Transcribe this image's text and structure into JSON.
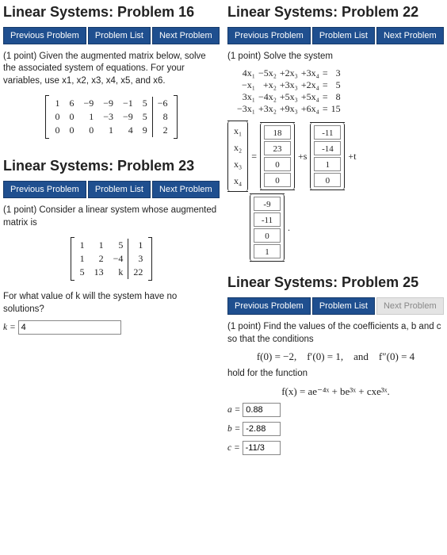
{
  "nav": {
    "prev": "Previous Problem",
    "list": "Problem List",
    "next": "Next Problem"
  },
  "p16": {
    "title": "Linear Systems: Problem 16",
    "prompt": "(1 point) Given the augmented matrix below, solve the associated system of equations. For your variables, use x1, x2, x3, x4, x5, and x6.",
    "matrix": {
      "rows": [
        [
          "1",
          "6",
          "−9",
          "−9",
          "−1",
          "5",
          "−6"
        ],
        [
          "0",
          "0",
          "1",
          "−3",
          "−9",
          "5",
          "8"
        ],
        [
          "0",
          "0",
          "0",
          "1",
          "4",
          "9",
          "2"
        ]
      ],
      "augcol": 6
    }
  },
  "p22": {
    "title": "Linear Systems: Problem 22",
    "prompt": "(1 point) Solve the system",
    "equations": [
      [
        "4x₁",
        "−5x₂",
        "+2x₃",
        "+3x₄",
        "=",
        "3"
      ],
      [
        "−x₁",
        "+x₂",
        "+3x₃",
        "+2x₄",
        "=",
        "5"
      ],
      [
        "3x₁",
        "−4x₂",
        "+5x₃",
        "+5x₄",
        "=",
        "8"
      ],
      [
        "−3x₁",
        "+3x₂",
        "+9x₃",
        "+6x₄",
        "=",
        "15"
      ]
    ],
    "xlabels": [
      "x₁",
      "x₂",
      "x₃",
      "x₄"
    ],
    "vec1": [
      "18",
      "23",
      "0",
      "0"
    ],
    "plus_s": "+s",
    "vec2": [
      "-11",
      "-14",
      "1",
      "0"
    ],
    "plus_t": "+t",
    "vec3": [
      "-9",
      "-11",
      "0",
      "1"
    ]
  },
  "p23": {
    "title": "Linear Systems: Problem 23",
    "prompt": "(1 point) Consider a linear system whose augmented matrix is",
    "matrix": {
      "rows": [
        [
          "1",
          "1",
          "5",
          "1"
        ],
        [
          "1",
          "2",
          "−4",
          "3"
        ],
        [
          "5",
          "13",
          "k",
          "22"
        ]
      ],
      "augcol": 3
    },
    "question": "For what value of k will the system have no solutions?",
    "klabel": "k =",
    "kvalue": "4"
  },
  "p25": {
    "title": "Linear Systems: Problem 25",
    "prompt": "(1 point) Find the values of the coefficients a, b and c so that the conditions",
    "conds": "f(0) = −2, f′(0) = 1, and f″(0) = 4",
    "hold": "hold for the function",
    "func": "f(x) = ae⁻⁴ˣ + be³ˣ + cxe³ˣ.",
    "labels": {
      "a": "a =",
      "b": "b =",
      "c": "c ="
    },
    "values": {
      "a": "0.88",
      "b": "-2.88",
      "c": "-11/3"
    },
    "next_disabled": true
  }
}
